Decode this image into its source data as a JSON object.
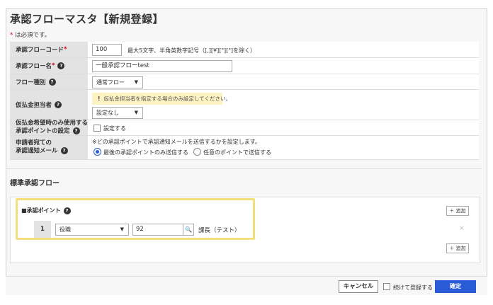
{
  "page": {
    "title": "承認フローマスタ【新規登録】",
    "required_star": "*",
    "required_note": " は必須です。"
  },
  "form": {
    "code": {
      "label": "承認フローコード",
      "star": "*",
      "value": "100",
      "hint": "最大5文字、半角英数字記号（[,][¥][\"][\"]を除く）"
    },
    "name": {
      "label": "承認フロー名",
      "star": "*",
      "value": "一般承認フローtest"
    },
    "type": {
      "label": "フロー種別",
      "value": "通常フロー"
    },
    "payee": {
      "label": "仮払金担当者",
      "warning": "仮払金担当者を指定する場合のみ設定してください。",
      "value": "設定なし"
    },
    "advance_point": {
      "label_line1": "仮払金希望時のみ使用する",
      "label_line2": "承認ポイントの設定",
      "checkbox_label": "設定する"
    },
    "notify": {
      "label_line1": "申請者宛ての",
      "label_line2": "承認通知メール",
      "hint": "※どの承認ポイントで承認通知メールを送信するかを設定します。",
      "option1": "最後の承認ポイントのみ送信する",
      "option2": "任意のポイントで送信する"
    }
  },
  "standard_flow": {
    "title": "標準承認フロー",
    "point_label": "■承認ポイント",
    "add_label": "＋ 追加",
    "step": {
      "number": "1",
      "type": "役職",
      "code": "92",
      "name": "課長（テスト）",
      "delete": "×"
    }
  },
  "footer": {
    "cancel": "キャンセル",
    "continue_label": "続けて登録する",
    "confirm": "確定"
  },
  "icons": {
    "help": "question-circle-icon",
    "search": "search-icon",
    "caret": "caret-down-icon",
    "warning": "exclamation-icon"
  },
  "colors": {
    "primary": "#2a5bd7",
    "highlight": "#f3e07c",
    "warning_bg": "#fdf2c2",
    "required": "#d0021b"
  }
}
